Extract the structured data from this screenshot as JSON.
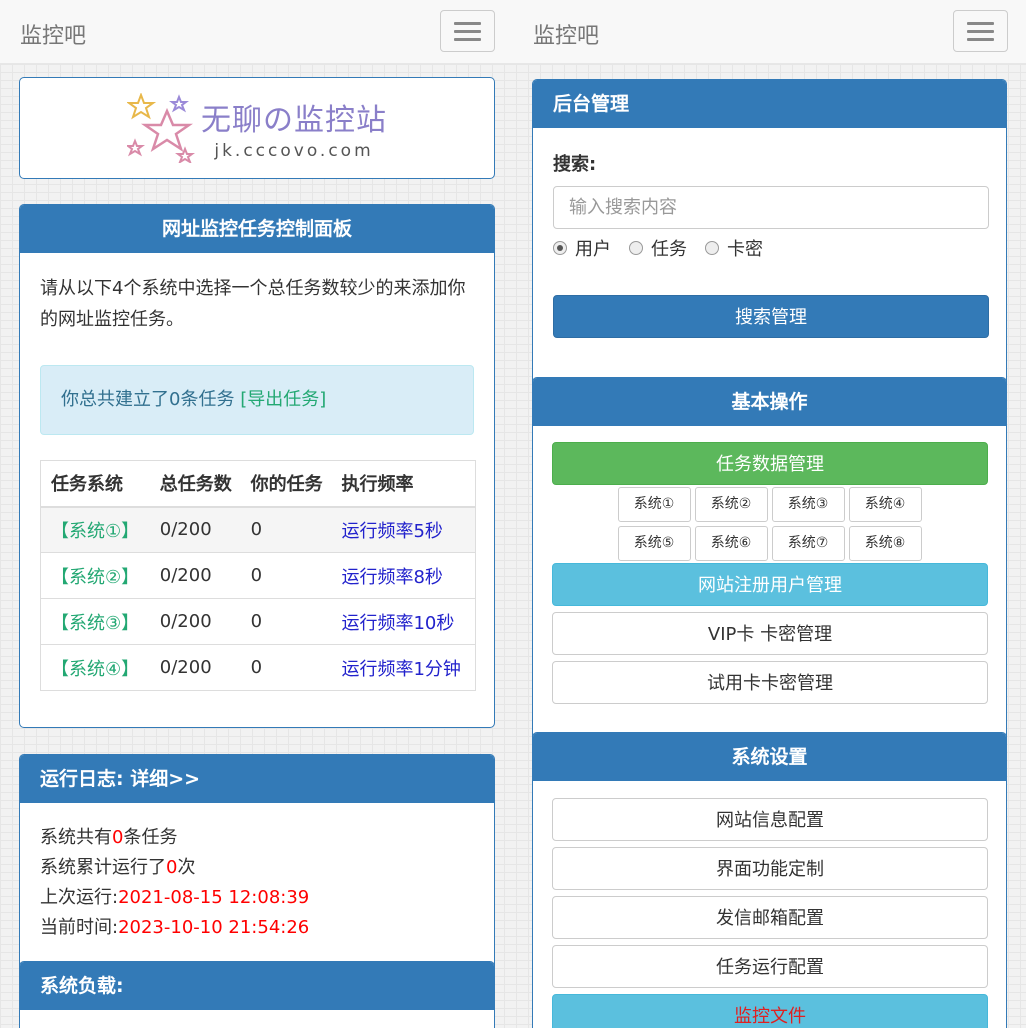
{
  "left": {
    "navbar": {
      "brand": "监控吧"
    },
    "logo": {
      "title": "无聊の监控站",
      "url": "jk.cccovo.com"
    },
    "control_panel": {
      "title": "网址监控任务控制面板",
      "intro": "请从以下4个系统中选择一个总任务数较少的来添加你的网址监控任务。",
      "alert_text": "你总共建立了0条任务 ",
      "alert_link": "[导出任务]",
      "headers": [
        "任务系统",
        "总任务数",
        "你的任务",
        "执行频率"
      ],
      "rows": [
        {
          "system": "【系统①】",
          "total": "0/200",
          "mine": "0",
          "freq": "运行频率5秒"
        },
        {
          "system": "【系统②】",
          "total": "0/200",
          "mine": "0",
          "freq": "运行频率8秒"
        },
        {
          "system": "【系统③】",
          "total": "0/200",
          "mine": "0",
          "freq": "运行频率10秒"
        },
        {
          "system": "【系统④】",
          "total": "0/200",
          "mine": "0",
          "freq": "运行频率1分钟"
        }
      ]
    },
    "log": {
      "title": "运行日志:  详细>>",
      "line1_prefix": "系统共有",
      "line1_value": "0",
      "line1_suffix": "条任务",
      "line2_prefix": "系统累计运行了",
      "line2_value": "0",
      "line2_suffix": "次",
      "line3_prefix": "上次运行:",
      "line3_value": "2021-08-15 12:08:39",
      "line4_prefix": "当前时间:",
      "line4_value": "2023-10-10 21:54:26"
    },
    "load": {
      "title": "系统负载:"
    }
  },
  "right": {
    "navbar": {
      "brand": "监控吧"
    },
    "admin": {
      "title": "后台管理",
      "search_label": "搜索:",
      "search_placeholder": "输入搜索内容",
      "radios": [
        "用户",
        "任务",
        "卡密"
      ],
      "search_button": "搜索管理"
    },
    "ops": {
      "title": "基本操作",
      "task_data": "任务数据管理",
      "systems": [
        "系统①",
        "系统②",
        "系统③",
        "系统④",
        "系统⑤",
        "系统⑥",
        "系统⑦",
        "系统⑧"
      ],
      "users": "网站注册用户管理",
      "vip": "VIP卡 卡密管理",
      "trial": "试用卡卡密管理"
    },
    "settings": {
      "title": "系统设置",
      "items": [
        "网站信息配置",
        "界面功能定制",
        "发信邮箱配置",
        "任务运行配置"
      ],
      "monitor_file": "监控文件"
    }
  },
  "colors": {
    "primary": "#337ab7",
    "success": "#5cb85c",
    "info": "#5bc0de",
    "link_green": "#23a873",
    "red": "#ff0000"
  }
}
